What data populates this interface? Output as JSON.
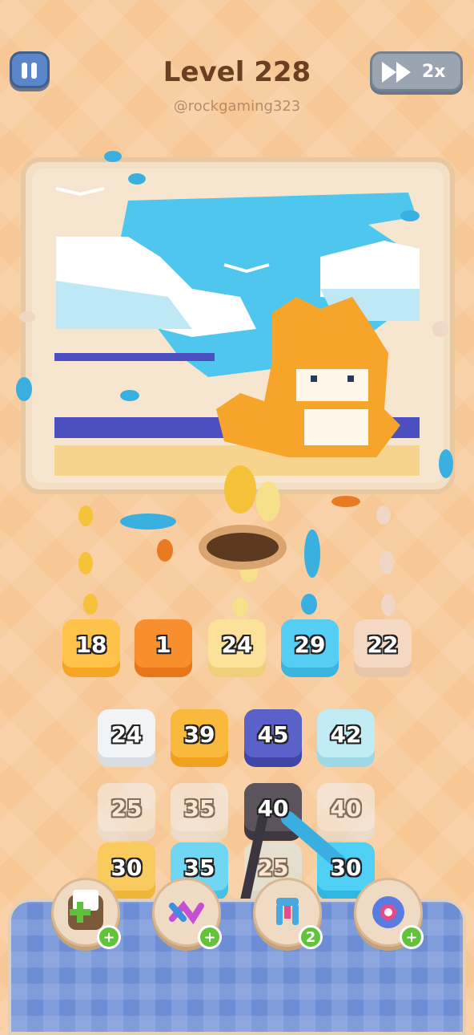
{
  "header": {
    "level": "Level 228",
    "handle": "@rockgaming323",
    "speed_label": "2x"
  },
  "queue": [
    {
      "value": "18",
      "color": "#f5a623",
      "top": "#ffc24a"
    },
    {
      "value": "1",
      "color": "#e8751a",
      "top": "#f78f2e"
    },
    {
      "value": "24",
      "color": "#efd07a",
      "top": "#fbe19a"
    },
    {
      "value": "29",
      "color": "#3bb5df",
      "top": "#56cdf2"
    },
    {
      "value": "22",
      "color": "#e8c4a8",
      "top": "#f5d8c2"
    }
  ],
  "grid": {
    "row1": [
      {
        "value": "24",
        "color": "#d9dde2",
        "top": "#f1f3f5"
      },
      {
        "value": "39",
        "color": "#f0a21e",
        "top": "#f9b93c"
      },
      {
        "value": "45",
        "color": "#3f46a8",
        "top": "#5a62c9"
      },
      {
        "value": "42",
        "color": "#9ed8e6",
        "top": "#c2ecf3"
      }
    ],
    "row2": [
      {
        "value": "25",
        "color": "#e3e3e3",
        "top": "#f2f2f2"
      },
      {
        "value": "35",
        "color": "#e3e3e3",
        "top": "#f2f2f2"
      },
      {
        "value": "40",
        "color": "#3e3940",
        "top": "#5b545c"
      },
      {
        "value": "40",
        "color": "#e3e3e3",
        "top": "#f2f2f2"
      }
    ],
    "row3": [
      {
        "value": "30",
        "color": "#f0b63a",
        "top": "#f9cb5e"
      },
      {
        "value": "35",
        "color": "#43c2e6",
        "top": "#70d6f2"
      },
      {
        "value": "25",
        "color": "#b9e4ef",
        "top": "#d4eff6"
      },
      {
        "value": "30",
        "color": "#31b8e2",
        "top": "#4fd0f5"
      }
    ]
  },
  "powerups": [
    {
      "name": "add-box",
      "badge": "+",
      "color": "#7fbf5a"
    },
    {
      "name": "shuffle",
      "badge": "+",
      "color": "#c44fd3"
    },
    {
      "name": "magnet",
      "badge": "2",
      "color": "#4aa8e0"
    },
    {
      "name": "freeze",
      "badge": "+",
      "color": "#5a7be0"
    }
  ]
}
